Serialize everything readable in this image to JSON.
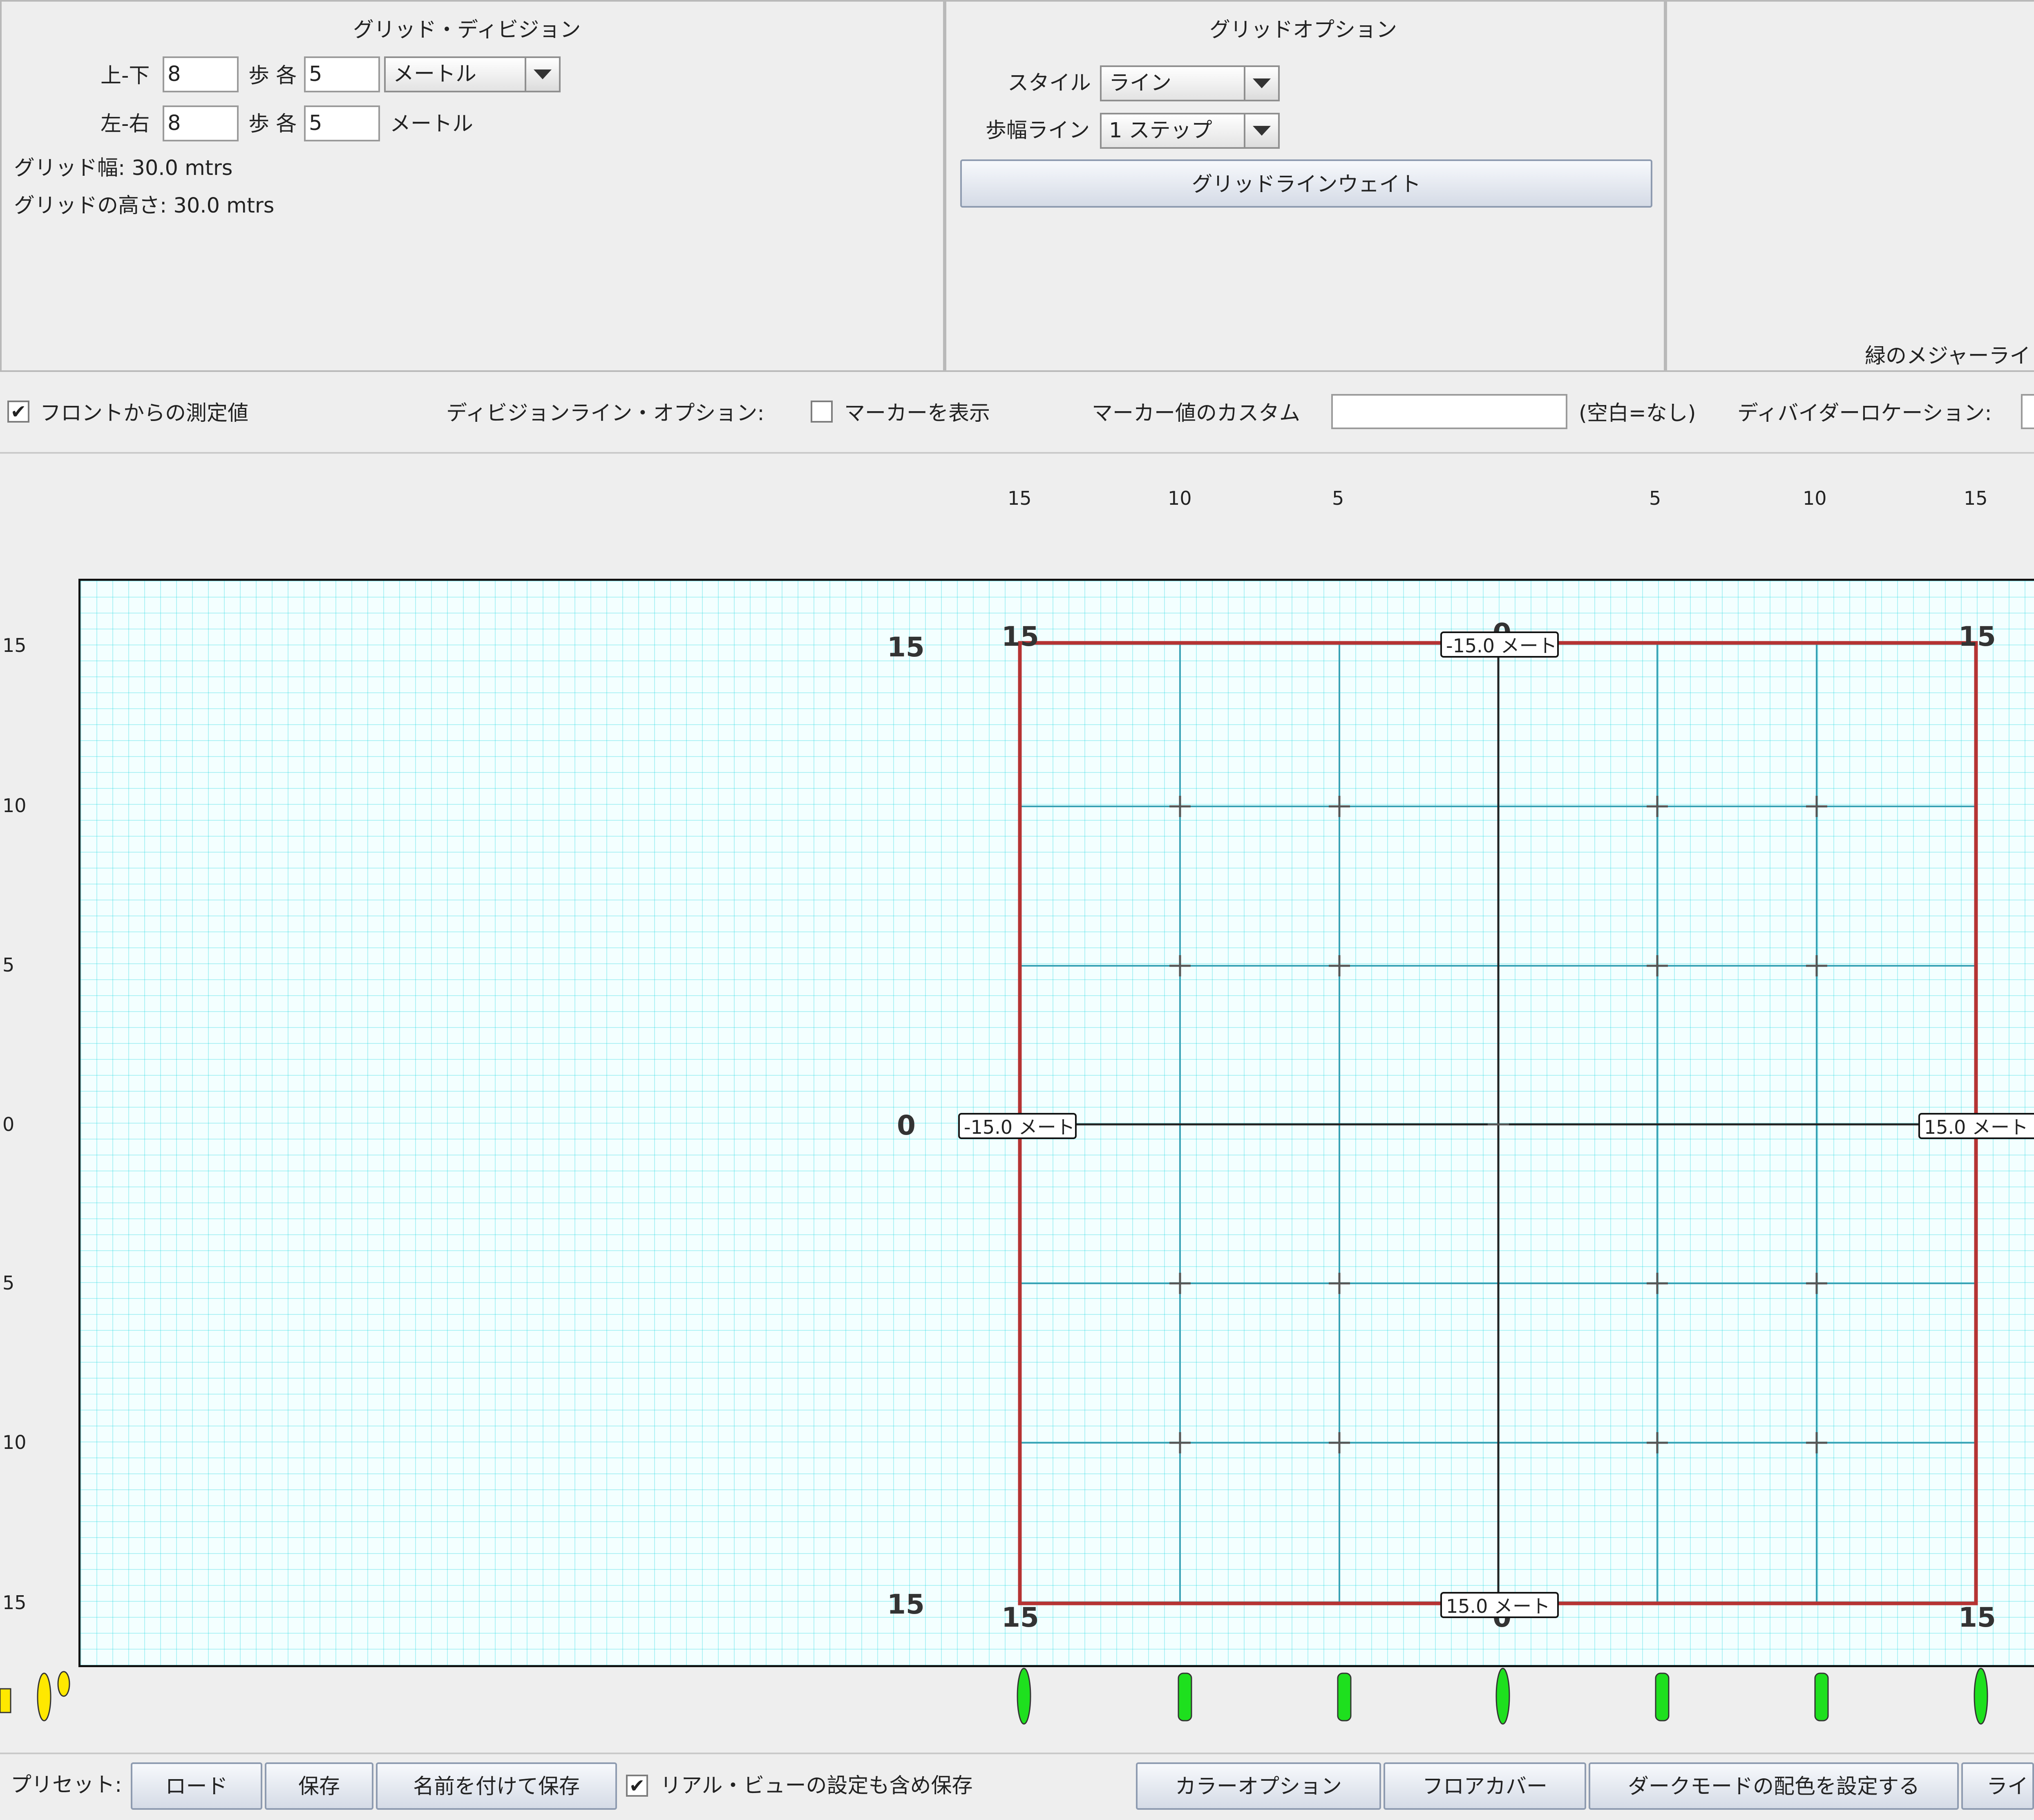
{
  "grid_division": {
    "title": "グリッド・ディビジョン",
    "ud_label": "上-下",
    "ud_value": "8",
    "step_label_1": "歩 各",
    "ud_step": "5",
    "unit_select": "メートル",
    "lr_label": "左-右",
    "lr_value": "8",
    "step_label_2": "歩 各",
    "lr_step": "5",
    "lr_unit": "メートル",
    "width_text": "グリッド幅: 30.0 mtrs",
    "height_text": "グリッドの高さ: 30.0 mtrs"
  },
  "grid_options": {
    "title": "グリッドオプション",
    "style_label": "スタイル",
    "style_value": "ライン",
    "step_line_label": "歩幅ライン",
    "step_line_value": "1 ステップ",
    "weight_button": "グリッドラインウェイト"
  },
  "right_panel": {
    "green_major_label": "緑のメジャーライ"
  },
  "options_bar": {
    "measure_front_label": "フロントからの測定値",
    "measure_front_checked": true,
    "division_options_label": "ディビジョンライン・オプション:",
    "show_marker_label": "マーカーを表示",
    "show_marker_checked": false,
    "marker_custom_label": "マーカー値のカスタム",
    "marker_custom_value": "",
    "blank_none_label": "(空白=なし)",
    "divider_location_label": "ディバイダーロケーション:"
  },
  "canvas": {
    "top_ruler": [
      "15",
      "10",
      "5",
      "5",
      "10",
      "15"
    ],
    "left_ruler": [
      "15",
      "10",
      "5",
      "0",
      "5",
      "10",
      "15"
    ],
    "big_left_numbers": [
      "15",
      "0",
      "15"
    ],
    "corner_numbers": [
      "15",
      "15",
      "15",
      "15"
    ],
    "center_numbers": [
      "0",
      "0"
    ],
    "labels": {
      "top": "-15.0 メート",
      "bottom": "15.0 メート",
      "left": "-15.0 メート",
      "right": "15.0 メート"
    },
    "colors": {
      "border_red": "#b53333",
      "division_teal": "#39a2b5",
      "center_dark": "#222222",
      "fine_grid": "#9eeef2"
    }
  },
  "presets_bar": {
    "label": "プリセット:",
    "load": "ロード",
    "save": "保存",
    "save_as": "名前を付けて保存",
    "include_real_view_label": "リアル・ビューの設定も含め保存",
    "include_real_view_checked": true,
    "color_options": "カラーオプション",
    "floor_cover": "フロアカバー",
    "dark_mode": "ダークモードの配色を設定する",
    "ra": "ライ"
  }
}
